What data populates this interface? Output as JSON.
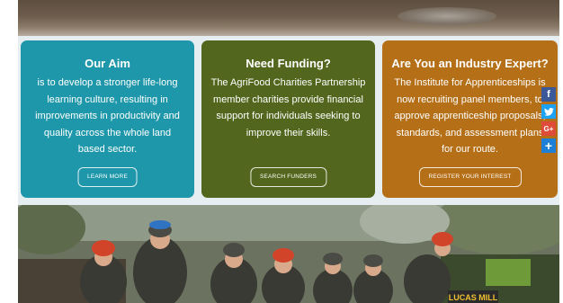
{
  "cards": [
    {
      "title": "Our Aim",
      "body": "is to develop a stronger life-long learning culture, resulting in improvements in productivity and quality across the whole land based sector.",
      "button": "LEARN MORE",
      "color": "#1e97aa"
    },
    {
      "title": "Need Funding?",
      "body": "The AgriFood Charities Partnership member charities provide financial support for individuals seeking to improve their skills.",
      "button": "SEARCH FUNDERS",
      "color": "#52671d"
    },
    {
      "title": "Are You an Industry Expert?",
      "body": "The Institute for Apprenticeships is now recruiting panel members, to approve apprenticeship proposals, standards, and assessment plans for our route.",
      "button": "REGISTER YOUR INTEREST",
      "color": "#b56f17"
    }
  ],
  "social": [
    {
      "label": "f",
      "icon": "facebook-icon",
      "color": "#3b5998"
    },
    {
      "label": "t",
      "icon": "twitter-icon",
      "color": "#1da1f2"
    },
    {
      "label": "G+",
      "icon": "google-plus-icon",
      "color": "#dd4b39"
    },
    {
      "label": "+",
      "icon": "share-plus-icon",
      "color": "#1d7fd6"
    }
  ],
  "photo": {
    "sign_text": "LUCAS MILL"
  }
}
